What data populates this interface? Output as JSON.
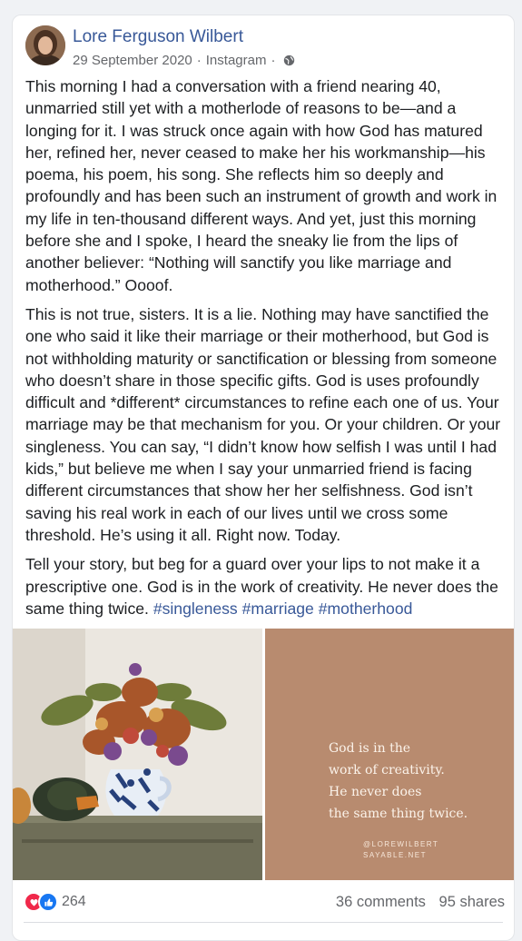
{
  "post": {
    "author": "Lore Ferguson Wilbert",
    "date": "29 September 2020",
    "source": "Instagram",
    "separator": "·",
    "paragraphs": [
      "This morning I had a conversation with a friend nearing 40, unmarried still yet with a motherlode of reasons to be—and a longing for it. I was struck once again with how God has matured her, refined her, never ceased to make her his workmanship—his poema, his poem, his song. She reflects him so deeply and profoundly and has been such an instrument of growth and work in my life in ten-thousand different ways. And yet, just this morning before she and I spoke, I heard the sneaky lie from the lips of another believer: “Nothing will sanctify you like marriage and motherhood.” Oooof.",
      "This is not true, sisters. It is a lie. Nothing may have sanctified the one who said it like their marriage or their motherhood, but God is not withholding maturity or sanctification or blessing from someone who doesn’t share in those specific gifts. God is uses profoundly difficult and *different* circumstances to refine each one of us. Your marriage may be that mechanism for you. Or your children. Or your singleness. You can say, “I didn’t know how selfish I was until I had kids,” but believe me when I say your unmarried friend is facing different circumstances that show her her selfishness. God isn’t saving his real work in each of our lives until we cross some threshold. He’s using it all. Right now. Today."
    ],
    "last_paragraph": "Tell your story, but beg for a guard over your lips to not make it a prescriptive one. God is in the work of creativity. He never does the same thing twice. ",
    "hashtags": [
      "#singleness",
      "#marriage",
      "#motherhood"
    ]
  },
  "quote_image": {
    "lines": [
      "God is in the",
      "work of creativity.",
      "He never does",
      "the same thing twice."
    ],
    "credit_handle": "@LOREWILBERT",
    "credit_site": "SAYABLE.NET"
  },
  "footer": {
    "reaction_count": "264",
    "comments": "36 comments",
    "shares": "95 shares"
  },
  "icons": {
    "love": "love-reaction-icon",
    "like": "like-reaction-icon",
    "globe": "globe-icon"
  },
  "colors": {
    "link": "#385898",
    "love": "#f0284a",
    "like": "#1877f2",
    "quote_bg": "#b88b6f"
  }
}
